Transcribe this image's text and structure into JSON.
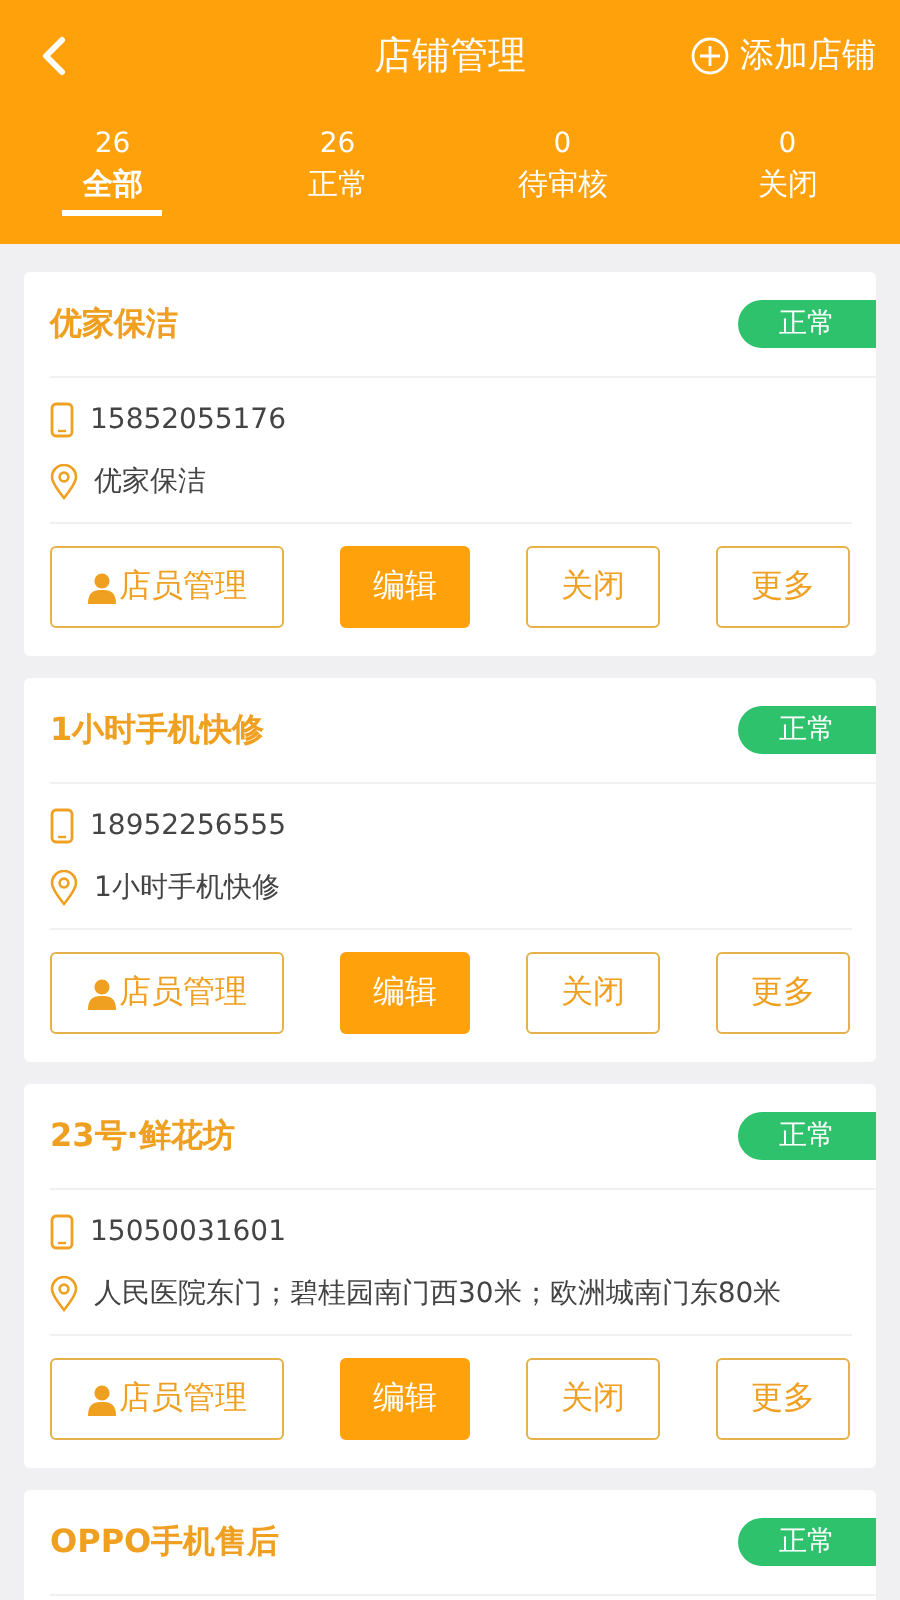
{
  "header": {
    "title": "店铺管理",
    "action": "添加店铺"
  },
  "tabs": [
    {
      "count": "26",
      "label": "全部",
      "selected": true
    },
    {
      "count": "26",
      "label": "正常",
      "selected": false
    },
    {
      "count": "0",
      "label": "待审核",
      "selected": false
    },
    {
      "count": "0",
      "label": "关闭",
      "selected": false
    }
  ],
  "shops": [
    {
      "name": "优家保洁",
      "status": "正常",
      "phone": "15852055176",
      "address": "优家保洁",
      "buttons": [
        {
          "label": "店员管理",
          "kind": "staff"
        },
        {
          "label": "编辑",
          "kind": "primary"
        },
        {
          "label": "关闭",
          "kind": "outline"
        },
        {
          "label": "更多",
          "kind": "outline"
        }
      ]
    },
    {
      "name": "1小时手机快修",
      "status": "正常",
      "phone": "18952256555",
      "address": "1小时手机快修",
      "buttons": [
        {
          "label": "店员管理",
          "kind": "staff"
        },
        {
          "label": "编辑",
          "kind": "primary"
        },
        {
          "label": "关闭",
          "kind": "outline"
        },
        {
          "label": "更多",
          "kind": "outline"
        }
      ]
    },
    {
      "name": "23号·鲜花坊",
      "status": "正常",
      "phone": "15050031601",
      "address": "人民医院东门；碧桂园南门西30米；欧洲城南门东80米",
      "buttons": [
        {
          "label": "店员管理",
          "kind": "staff"
        },
        {
          "label": "编辑",
          "kind": "primary"
        },
        {
          "label": "关闭",
          "kind": "outline"
        },
        {
          "label": "更多",
          "kind": "outline"
        }
      ]
    },
    {
      "name": "OPPO手机售后",
      "status": "正常"
    }
  ]
}
